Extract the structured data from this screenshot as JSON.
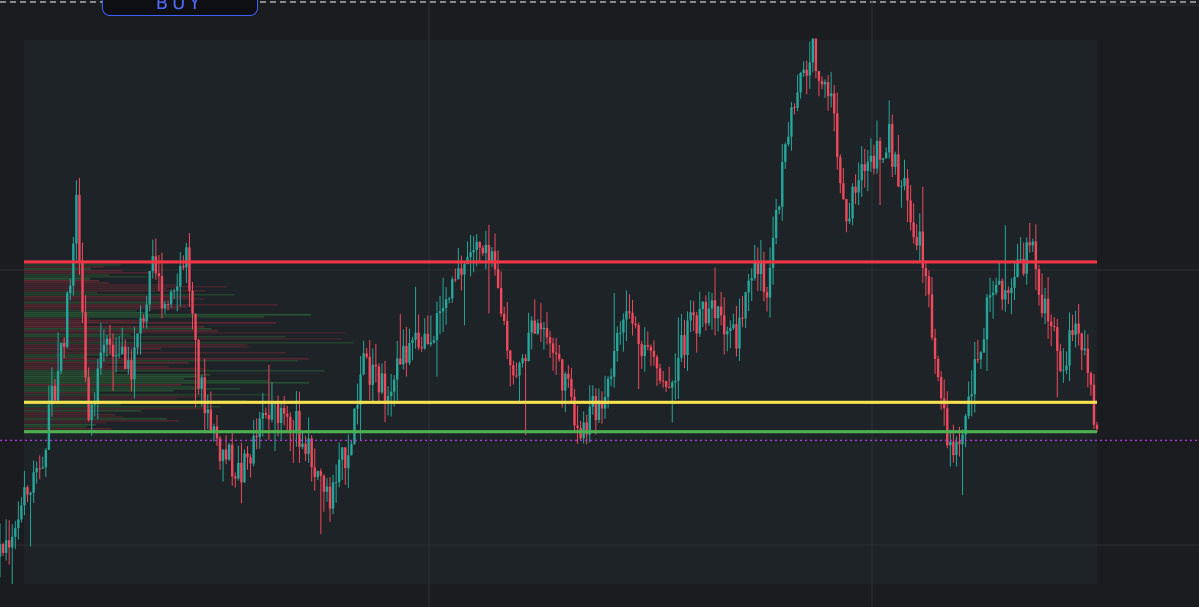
{
  "buy_button": {
    "label": "BUY"
  },
  "colors": {
    "background": "#1b1c1f",
    "plot_area": "#1d2326",
    "grid": "#2b2f33",
    "candle_up": "#26a69a",
    "candle_down": "#f0485c",
    "resistance": "#f23645",
    "mid_level": "#f5e04f",
    "support": "#4caf50",
    "current_price": "#b536e6",
    "top_dashed": "#c9cbd0",
    "volume_profile_green": "#2d6b3a",
    "volume_profile_red": "#7a2a38"
  },
  "chart_data": {
    "type": "candlestick",
    "y_range": [
      0,
      100
    ],
    "levels": [
      {
        "kind": "resistance",
        "value": 59.2
      },
      {
        "kind": "mid",
        "value": 33.4
      },
      {
        "kind": "support",
        "value": 28.0
      },
      {
        "kind": "current-price",
        "value": 26.4
      }
    ],
    "price_path": [
      [
        0,
        5
      ],
      [
        2,
        14
      ],
      [
        4,
        25
      ],
      [
        6,
        48
      ],
      [
        7,
        70
      ],
      [
        8,
        32
      ],
      [
        10,
        45
      ],
      [
        12,
        40
      ],
      [
        14,
        58
      ],
      [
        15,
        52
      ],
      [
        17,
        61
      ],
      [
        18,
        38
      ],
      [
        20,
        25
      ],
      [
        22,
        20
      ],
      [
        24,
        30
      ],
      [
        26,
        33
      ],
      [
        28,
        25
      ],
      [
        30,
        15
      ],
      [
        32,
        27
      ],
      [
        33,
        40
      ],
      [
        35,
        36
      ],
      [
        37,
        42
      ],
      [
        40,
        48
      ],
      [
        43,
        62
      ],
      [
        45,
        58
      ],
      [
        47,
        37
      ],
      [
        49,
        50
      ],
      [
        51,
        40
      ],
      [
        53,
        28
      ],
      [
        55,
        35
      ],
      [
        57,
        50
      ],
      [
        59,
        43
      ],
      [
        61,
        37
      ],
      [
        63,
        48
      ],
      [
        65,
        52
      ],
      [
        67,
        45
      ],
      [
        69,
        58
      ],
      [
        70,
        55
      ],
      [
        72,
        85
      ],
      [
        74,
        98
      ],
      [
        76,
        88
      ],
      [
        77,
        66
      ],
      [
        79,
        78
      ],
      [
        81,
        82
      ],
      [
        83,
        68
      ],
      [
        84,
        63
      ],
      [
        86,
        30
      ],
      [
        87,
        22
      ],
      [
        88,
        30
      ],
      [
        90,
        50
      ],
      [
        92,
        56
      ],
      [
        94,
        62
      ],
      [
        95,
        52
      ],
      [
        97,
        38
      ],
      [
        98,
        50
      ],
      [
        99,
        40
      ],
      [
        100,
        26
      ]
    ]
  }
}
